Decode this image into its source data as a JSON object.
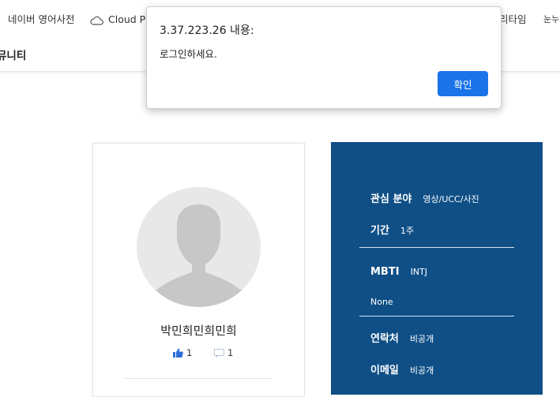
{
  "bookmarks": {
    "item1": "네이버 영어사전",
    "item2": "Cloud PC",
    "item3": "리타임",
    "item4": "눈누"
  },
  "site": {
    "nav_title": "뮤니티"
  },
  "profile": {
    "name": "박민희민희민희",
    "likes": "1",
    "comments": "1"
  },
  "info": {
    "interest_label": "관심 분야",
    "interest_value": "영상/UCC/사진",
    "period_label": "기간",
    "period_value": "1주",
    "mbti_label": "MBTI",
    "mbti_value": "INTJ",
    "mbti_extra": "None",
    "contact_label": "연락처",
    "contact_value": "비공개",
    "email_label": "이메일",
    "email_value": "비공개"
  },
  "dialog": {
    "title": "3.37.223.26 내용:",
    "message": "로그인하세요.",
    "ok_label": "확인"
  },
  "colors": {
    "panel": "#0f4f86",
    "button": "#1a73e8"
  }
}
